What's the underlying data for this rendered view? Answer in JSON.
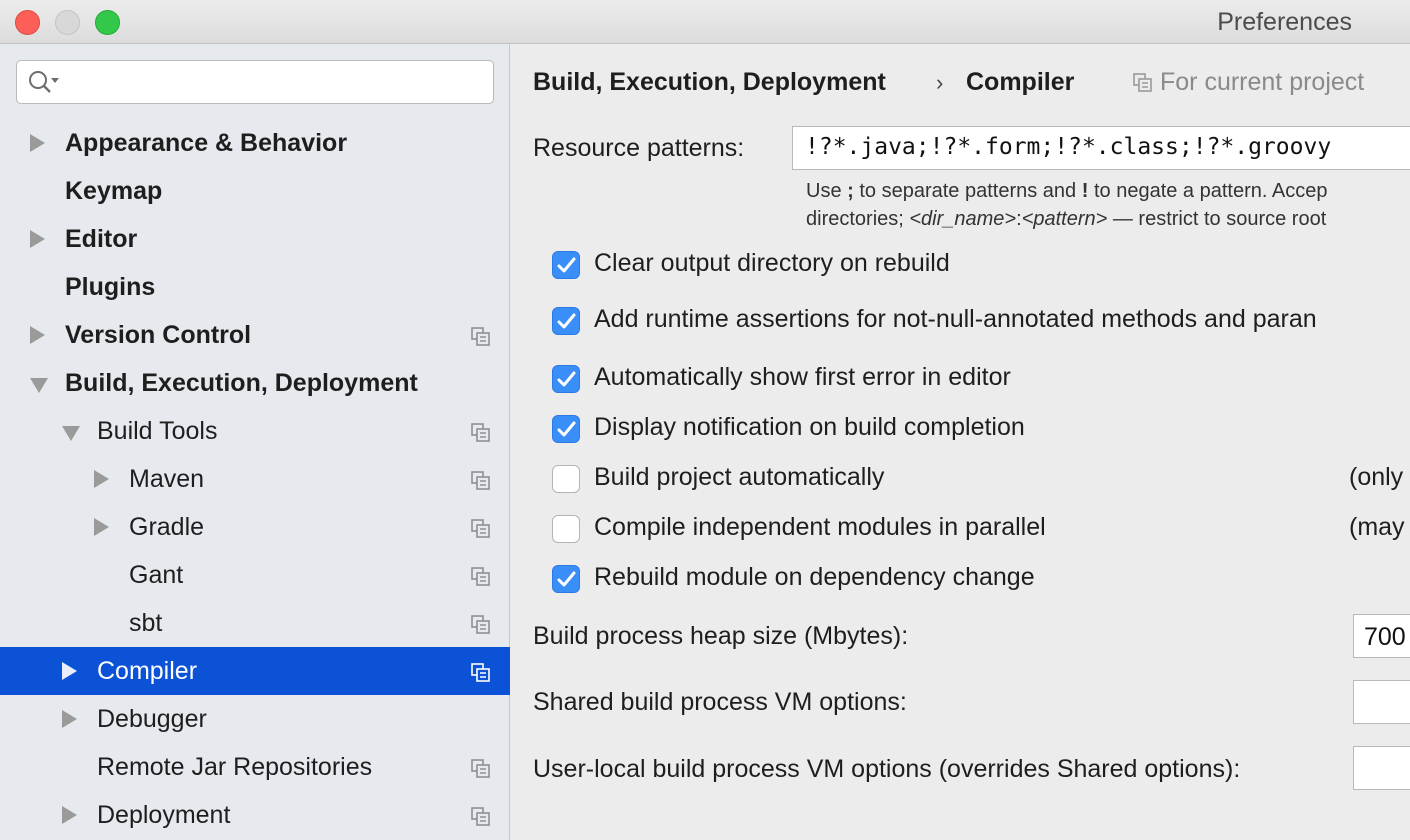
{
  "window": {
    "title": "Preferences"
  },
  "search": {
    "placeholder": "",
    "value": ""
  },
  "tree": [
    {
      "label": "Appearance & Behavior",
      "bold": true,
      "arrow": "right",
      "indent": 0,
      "project_icon": false,
      "selected": false
    },
    {
      "label": "Keymap",
      "bold": true,
      "arrow": "none",
      "indent": 0,
      "project_icon": false,
      "selected": false
    },
    {
      "label": "Editor",
      "bold": true,
      "arrow": "right",
      "indent": 0,
      "project_icon": false,
      "selected": false
    },
    {
      "label": "Plugins",
      "bold": true,
      "arrow": "none",
      "indent": 0,
      "project_icon": false,
      "selected": false
    },
    {
      "label": "Version Control",
      "bold": true,
      "arrow": "right",
      "indent": 0,
      "project_icon": true,
      "selected": false
    },
    {
      "label": "Build, Execution, Deployment",
      "bold": true,
      "arrow": "down",
      "indent": 0,
      "project_icon": false,
      "selected": false
    },
    {
      "label": "Build Tools",
      "bold": false,
      "arrow": "down",
      "indent": 1,
      "project_icon": true,
      "selected": false
    },
    {
      "label": "Maven",
      "bold": false,
      "arrow": "right",
      "indent": 2,
      "project_icon": true,
      "selected": false
    },
    {
      "label": "Gradle",
      "bold": false,
      "arrow": "right",
      "indent": 2,
      "project_icon": true,
      "selected": false
    },
    {
      "label": "Gant",
      "bold": false,
      "arrow": "none",
      "indent": 2,
      "project_icon": true,
      "selected": false
    },
    {
      "label": "sbt",
      "bold": false,
      "arrow": "none",
      "indent": 2,
      "project_icon": true,
      "selected": false
    },
    {
      "label": "Compiler",
      "bold": false,
      "arrow": "right",
      "indent": 1,
      "project_icon": true,
      "selected": true
    },
    {
      "label": "Debugger",
      "bold": false,
      "arrow": "right",
      "indent": 1,
      "project_icon": false,
      "selected": false
    },
    {
      "label": "Remote Jar Repositories",
      "bold": false,
      "arrow": "none",
      "indent": 1,
      "project_icon": true,
      "selected": false
    },
    {
      "label": "Deployment",
      "bold": false,
      "arrow": "right",
      "indent": 1,
      "project_icon": true,
      "selected": false
    }
  ],
  "breadcrumb": {
    "parent": "Build, Execution, Deployment",
    "separator": "›",
    "current": "Compiler",
    "scope": "For current project"
  },
  "resource_patterns": {
    "label": "Resource patterns:",
    "value": "!?*.java;!?*.form;!?*.class;!?*.groovy",
    "hint_line1_a": "Use ",
    "hint_line1_b": ";",
    "hint_line1_c": " to separate patterns and ",
    "hint_line1_d": "!",
    "hint_line1_e": " to negate a pattern. Accep",
    "hint_line2_a": "directories; ",
    "hint_line2_b": "<dir_name>",
    "hint_line2_c": ":",
    "hint_line2_d": "<pattern>",
    "hint_line2_e": " — restrict to source root"
  },
  "options": [
    {
      "label": "Clear output directory on rebuild",
      "checked": true,
      "note": ""
    },
    {
      "label": "Add runtime assertions for not-null-annotated methods and paran",
      "checked": true,
      "note": ""
    },
    {
      "label": "Automatically show first error in editor",
      "checked": true,
      "note": ""
    },
    {
      "label": "Display notification on build completion",
      "checked": true,
      "note": ""
    },
    {
      "label": "Build project automatically",
      "checked": false,
      "note": "(only"
    },
    {
      "label": "Compile independent modules in parallel",
      "checked": false,
      "note": "(may"
    },
    {
      "label": "Rebuild module on dependency change",
      "checked": true,
      "note": ""
    }
  ],
  "fields": {
    "heap_label": "Build process heap size (Mbytes):",
    "heap_value": "700",
    "shared_vm_label": "Shared build process VM options:",
    "shared_vm_value": "",
    "user_vm_label": "User-local build process VM options (overrides Shared options):",
    "user_vm_value": ""
  },
  "colors": {
    "selection": "#0b52d6",
    "checkbox_on": "#3a8ef7",
    "sidebar_bg": "#e6eaef",
    "content_bg": "#ececec"
  }
}
